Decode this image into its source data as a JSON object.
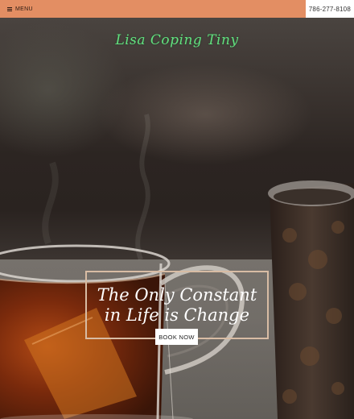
{
  "topbar": {
    "menu_label": "MENU",
    "menu_icon": "hamburger-icon",
    "phone": "786-277-8108",
    "background": "#e38e63"
  },
  "hero": {
    "logo_text": "Lisa Coping Tiny",
    "logo_color": "#62e07f",
    "headline_line1": "The Only Constant",
    "headline_line2": "in Life is Change",
    "cta_label": "BOOK NOW",
    "frame_color": "#d8bca4"
  }
}
